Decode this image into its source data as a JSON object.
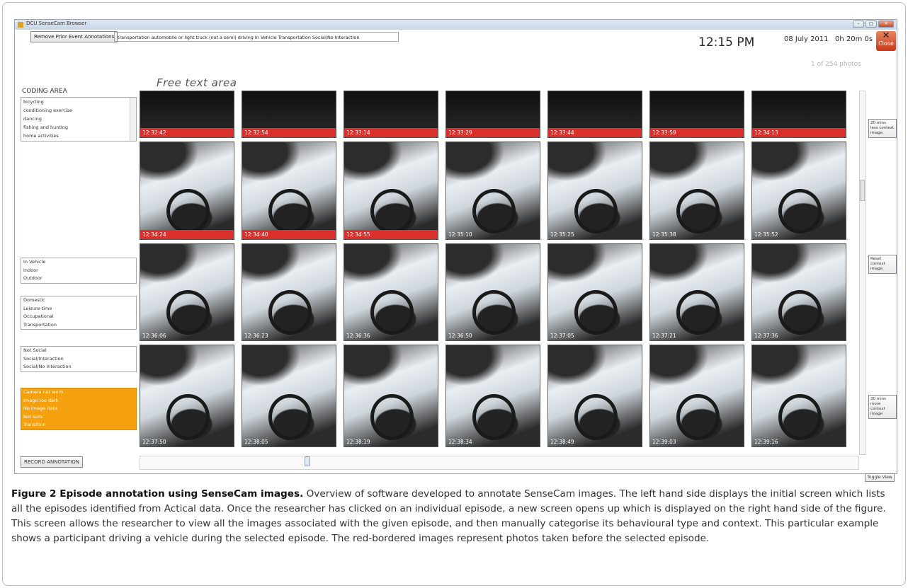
{
  "window": {
    "title": "DCU SenseCam Browser",
    "remove_button": "Remove Prior Event Annotations",
    "annotation_text": "transportation   automobile or light truck (not a semi) driving   In Vehicle   Transportation   Social/No Interaction",
    "time": "12:15 PM",
    "date": "08 July 2011",
    "duration": "0h 20m 0s",
    "close_label": "Close",
    "photo_count": "1 of 254 photos",
    "free_text": "Free text area"
  },
  "coding": {
    "title": "CODING AREA",
    "activities": [
      "bicycling",
      "conditioning exercise",
      "dancing",
      "fishing and hunting",
      "home activities"
    ],
    "groups": [
      {
        "items": [
          "In Vehicle",
          "Indoor",
          "Outdoor"
        ]
      },
      {
        "items": [
          "Domestic",
          "Leisure-time",
          "Occupational",
          "Transportation"
        ]
      },
      {
        "items": [
          "Not Social",
          "Social/Interaction",
          "Social/No Interaction"
        ]
      },
      {
        "items": [
          "Camera not worn",
          "Image too dark",
          "No image data",
          "Not sure",
          "Transition"
        ],
        "highlight": true
      }
    ],
    "record_button": "RECORD ANNOTATION"
  },
  "images": {
    "rows": [
      [
        {
          "time": "12:32:42",
          "prior": true,
          "dark": true
        },
        {
          "time": "12:32:54",
          "prior": true,
          "dark": true
        },
        {
          "time": "12:33:14",
          "prior": true,
          "dark": true
        },
        {
          "time": "12:33:29",
          "prior": true,
          "dark": true
        },
        {
          "time": "12:33:44",
          "prior": true,
          "dark": true
        },
        {
          "time": "12:33:59",
          "prior": true,
          "dark": true
        },
        {
          "time": "12:34:13",
          "prior": true,
          "dark": true
        }
      ],
      [
        {
          "time": "12:34:24",
          "prior": true
        },
        {
          "time": "12:34:40",
          "prior": true
        },
        {
          "time": "12:34:55",
          "prior": true
        },
        {
          "time": "12:35:10"
        },
        {
          "time": "12:35:25"
        },
        {
          "time": "12:35:38"
        },
        {
          "time": "12:35:52"
        }
      ],
      [
        {
          "time": "12:36:06"
        },
        {
          "time": "12:36:23"
        },
        {
          "time": "12:36:36"
        },
        {
          "time": "12:36:50"
        },
        {
          "time": "12:37:05"
        },
        {
          "time": "12:37:21"
        },
        {
          "time": "12:37:36"
        }
      ],
      [
        {
          "time": "12:37:50"
        },
        {
          "time": "12:38:05"
        },
        {
          "time": "12:38:19"
        },
        {
          "time": "12:38:34"
        },
        {
          "time": "12:38:49"
        },
        {
          "time": "12:39:03"
        },
        {
          "time": "12:39:16"
        }
      ]
    ]
  },
  "side_buttons": {
    "less": "20 mins less context image",
    "reset": "Reset context image",
    "more": "20 mins more context image",
    "toggle": "Toggle View"
  },
  "caption": {
    "bold": "Figure 2 Episode annotation using SenseCam images.",
    "text": " Overview of software developed to annotate SenseCam images. The left hand side displays the initial screen which lists all the episodes identified from Actical data. Once the researcher has clicked on an individual episode, a new screen opens up which is displayed on the right hand side of the figure. This screen allows the researcher to view all the images associated with the given episode, and then manually categorise its behavioural type and context. This particular example shows a participant driving a vehicle during the selected episode. The red-bordered images represent photos taken before the selected episode."
  },
  "colors": {
    "prior_label": "#d9302b",
    "highlight_group": "#f5a00f",
    "close_button": "#c8391a"
  }
}
